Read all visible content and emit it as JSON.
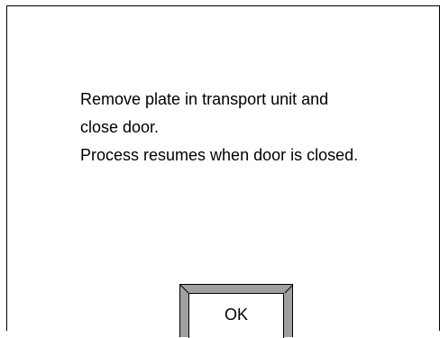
{
  "dialog": {
    "message_lines": [
      "Remove plate in transport unit and",
      "close door.",
      "Process resumes when door is closed."
    ],
    "ok_label": "OK"
  },
  "colors": {
    "background": "#ffffff",
    "border": "#000000",
    "button_bevel": "#a0a0a0"
  }
}
